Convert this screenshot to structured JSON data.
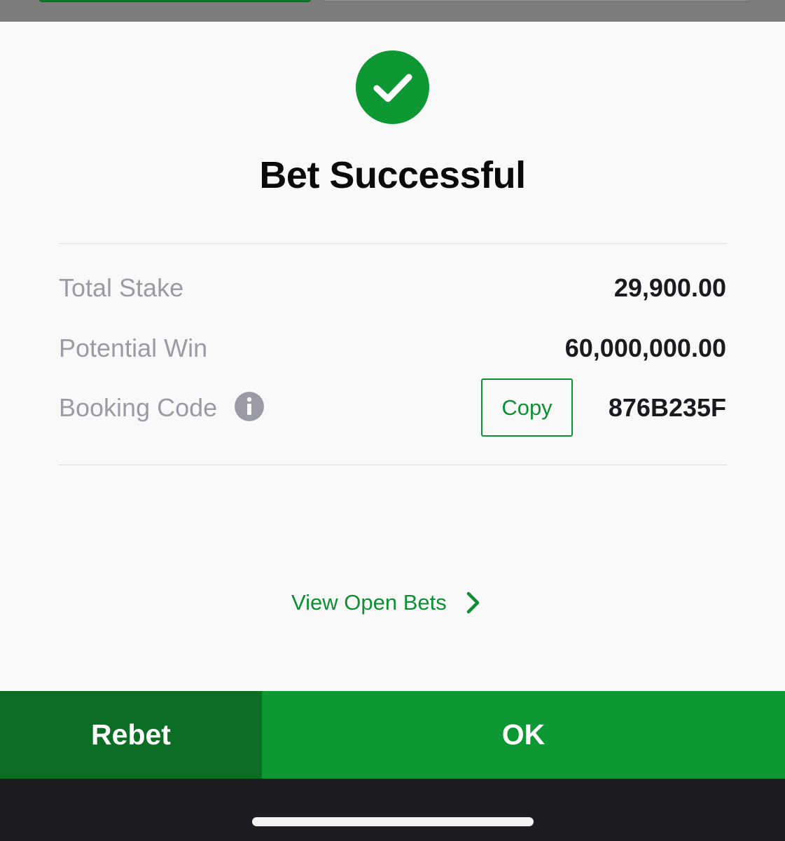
{
  "dialog": {
    "title": "Bet Successful",
    "status_icon": "checkmark-circle-icon",
    "accent_color": "#0e9834"
  },
  "summary": {
    "rows": [
      {
        "label": "Total Stake",
        "value": "29,900.00"
      },
      {
        "label": "Potential Win",
        "value": "60,000,000.00"
      },
      {
        "label": "Booking Code",
        "value": "876B235F"
      }
    ],
    "info_icon": "info-icon",
    "copy_label": "Copy"
  },
  "links": {
    "open_bets_label": "View Open Bets",
    "open_bets_icon": "chevron-right-icon"
  },
  "footer": {
    "rebet_label": "Rebet",
    "ok_label": "OK",
    "rebet_color": "#0c6e25",
    "ok_color": "#0e9834"
  }
}
